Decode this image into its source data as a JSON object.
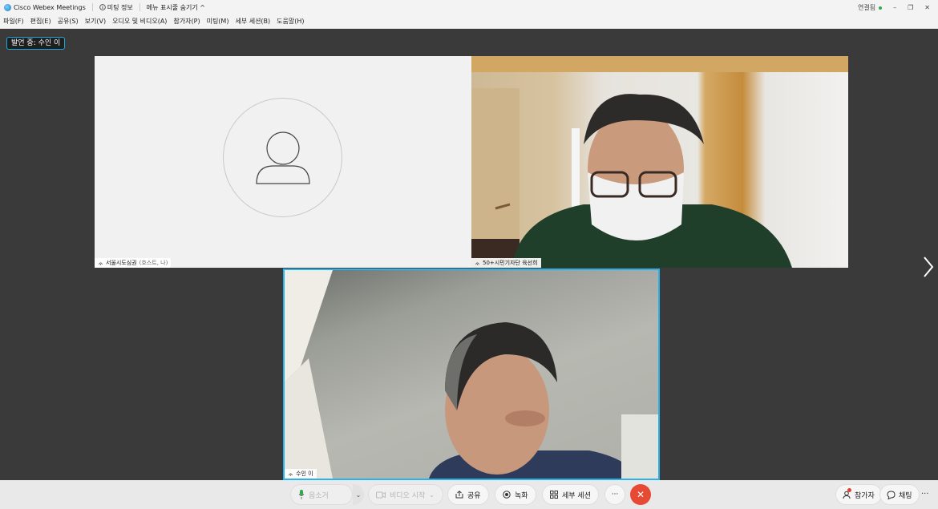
{
  "titlebar": {
    "app_title": "Cisco Webex Meetings",
    "meeting_info": "미팅 정보",
    "hide_menu": "메뉴 표시줄 숨기기 ^",
    "connection": "연결됨",
    "window_controls": [
      "–",
      "❐",
      "✕"
    ]
  },
  "menubar": {
    "items": [
      "파일(F)",
      "편집(E)",
      "공유(S)",
      "보기(V)",
      "오디오 및 비디오(A)",
      "참가자(P)",
      "미팅(M)",
      "세부 세션(B)",
      "도움말(H)"
    ]
  },
  "stage": {
    "speaking_label": "발언 중: 수인 이"
  },
  "tiles": {
    "host": {
      "name": "서울시도심권",
      "role": "(호스트, 나)"
    },
    "participant1": {
      "name": "50+시민기자단 육선희"
    },
    "participant2": {
      "name": "수인 이"
    }
  },
  "controls": {
    "mute_label": "음소거",
    "video_label": "비디오 시작",
    "share_label": "공유",
    "record_label": "녹화",
    "breakout_label": "세부 세션",
    "more_label": "···",
    "end_label": "✕",
    "participants_label": "참가자",
    "chat_label": "채팅",
    "more_right_label": "···"
  },
  "colors": {
    "accent": "#28b3ea",
    "end_call": "#e64a35",
    "stage_bg": "#3a3a3a",
    "connected": "#2fa84f"
  }
}
